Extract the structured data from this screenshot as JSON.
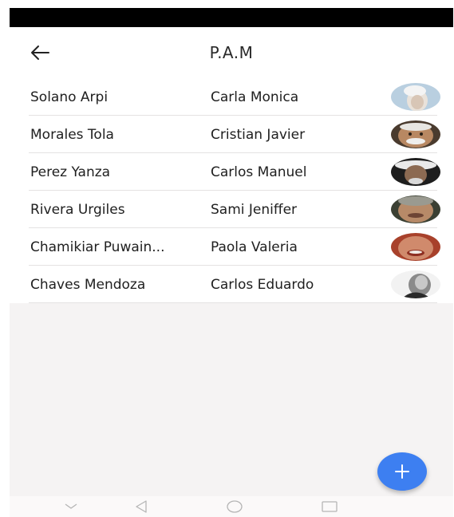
{
  "app_bar": {
    "title": "P.A.M",
    "back_icon": "arrow-left-icon"
  },
  "people": [
    {
      "last_name": "Solano Arpi",
      "first_name": "Carla Monica",
      "avatar": "elderly-person-photo"
    },
    {
      "last_name": "Morales Tola",
      "first_name": "Cristian Javier",
      "avatar": "elderly-person-photo"
    },
    {
      "last_name": "Perez Yanza",
      "first_name": "Carlos Manuel",
      "avatar": "elderly-person-photo"
    },
    {
      "last_name": "Rivera Urgiles",
      "first_name": "Sami Jeniffer",
      "avatar": "elderly-person-photo"
    },
    {
      "last_name": "Chamikiar Puwain...",
      "first_name": "Paola Valeria",
      "avatar": "elderly-person-photo"
    },
    {
      "last_name": "Chaves Mendoza",
      "first_name": "Carlos Eduardo",
      "avatar": "elderly-person-photo"
    }
  ],
  "fab": {
    "icon": "plus-icon"
  },
  "nav_bar": {
    "icons": [
      "chevron-down-icon",
      "back-triangle-icon",
      "home-circle-icon",
      "recents-square-icon"
    ]
  },
  "colors": {
    "accent": "#3d7ff1",
    "status_bar": "#000000",
    "background": "#f5f3f3"
  }
}
